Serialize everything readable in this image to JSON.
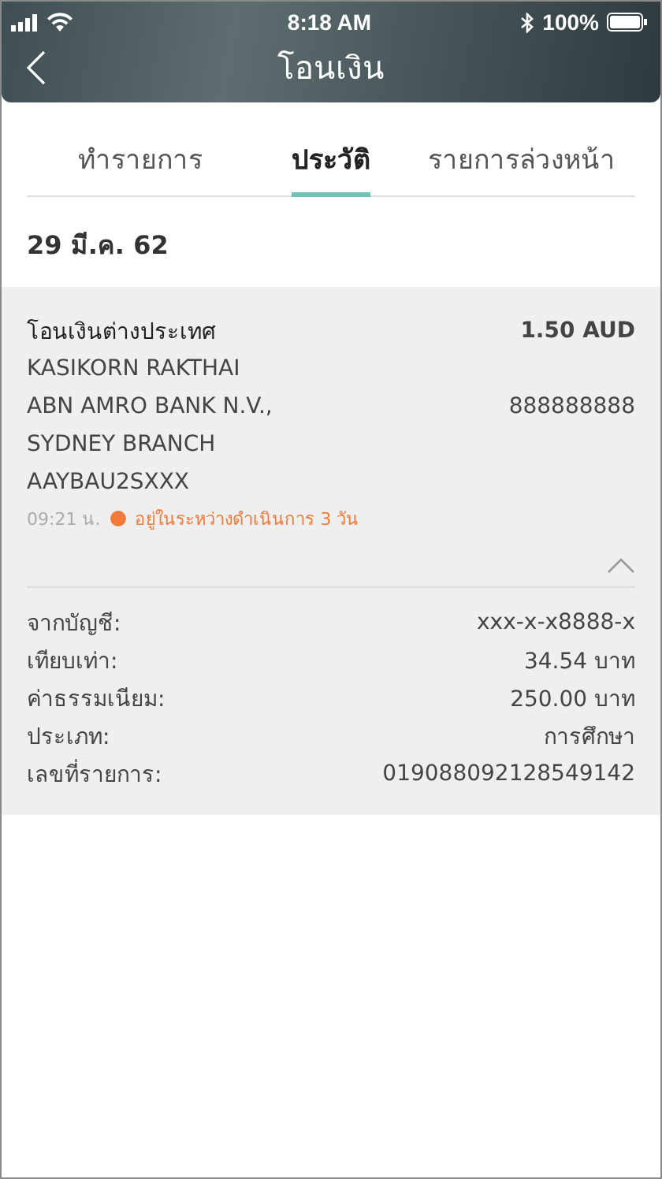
{
  "status_bar": {
    "time": "8:18 AM",
    "battery": "100%"
  },
  "header": {
    "title": "โอนเงิน"
  },
  "tabs": [
    {
      "label": "ทำรายการ",
      "selected": false
    },
    {
      "label": "ประวัติ",
      "selected": true
    },
    {
      "label": "รายการล่วงหน้า",
      "selected": false
    }
  ],
  "date": "29 มี.ค. 62",
  "transaction": {
    "title": "โอนเงินต่างประเทศ",
    "amount": "1.50 AUD",
    "lines": [
      {
        "text": "KASIKORN RAKTHAI"
      },
      {
        "text": "ABN AMRO BANK N.V.,",
        "value": "888888888"
      },
      {
        "text": "SYDNEY BRANCH"
      },
      {
        "text": "AAYBAU2SXXX"
      }
    ],
    "time": "09:21 น.",
    "status": {
      "text": "อยู่ในระหว่างดำเนินการ 3 วัน",
      "color": "#f07a3a"
    },
    "expanded": true,
    "details": [
      {
        "label": "จากบัญชี:",
        "value": "xxx-x-x8888-x"
      },
      {
        "label": "เทียบเท่า:",
        "value": "34.54 บาท"
      },
      {
        "label": "ค่าธรรมเนียม:",
        "value": "250.00 บาท"
      },
      {
        "label": "ประเภท:",
        "value": "การศึกษา"
      },
      {
        "label": "เลขที่รายการ:",
        "value": "019088092128549142"
      }
    ]
  }
}
